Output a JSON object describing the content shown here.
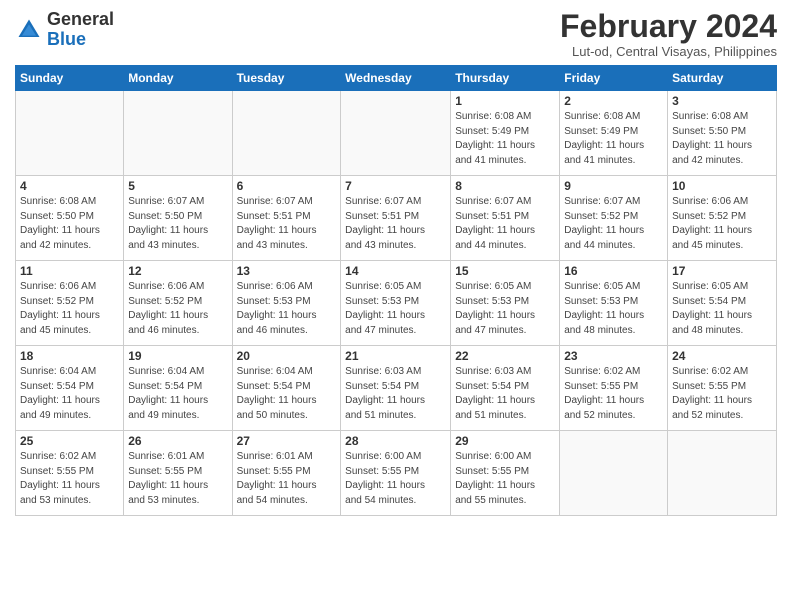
{
  "header": {
    "logo_general": "General",
    "logo_blue": "Blue",
    "month_title": "February 2024",
    "location": "Lut-od, Central Visayas, Philippines"
  },
  "weekdays": [
    "Sunday",
    "Monday",
    "Tuesday",
    "Wednesday",
    "Thursday",
    "Friday",
    "Saturday"
  ],
  "weeks": [
    [
      {
        "day": "",
        "info": ""
      },
      {
        "day": "",
        "info": ""
      },
      {
        "day": "",
        "info": ""
      },
      {
        "day": "",
        "info": ""
      },
      {
        "day": "1",
        "info": "Sunrise: 6:08 AM\nSunset: 5:49 PM\nDaylight: 11 hours\nand 41 minutes."
      },
      {
        "day": "2",
        "info": "Sunrise: 6:08 AM\nSunset: 5:49 PM\nDaylight: 11 hours\nand 41 minutes."
      },
      {
        "day": "3",
        "info": "Sunrise: 6:08 AM\nSunset: 5:50 PM\nDaylight: 11 hours\nand 42 minutes."
      }
    ],
    [
      {
        "day": "4",
        "info": "Sunrise: 6:08 AM\nSunset: 5:50 PM\nDaylight: 11 hours\nand 42 minutes."
      },
      {
        "day": "5",
        "info": "Sunrise: 6:07 AM\nSunset: 5:50 PM\nDaylight: 11 hours\nand 43 minutes."
      },
      {
        "day": "6",
        "info": "Sunrise: 6:07 AM\nSunset: 5:51 PM\nDaylight: 11 hours\nand 43 minutes."
      },
      {
        "day": "7",
        "info": "Sunrise: 6:07 AM\nSunset: 5:51 PM\nDaylight: 11 hours\nand 43 minutes."
      },
      {
        "day": "8",
        "info": "Sunrise: 6:07 AM\nSunset: 5:51 PM\nDaylight: 11 hours\nand 44 minutes."
      },
      {
        "day": "9",
        "info": "Sunrise: 6:07 AM\nSunset: 5:52 PM\nDaylight: 11 hours\nand 44 minutes."
      },
      {
        "day": "10",
        "info": "Sunrise: 6:06 AM\nSunset: 5:52 PM\nDaylight: 11 hours\nand 45 minutes."
      }
    ],
    [
      {
        "day": "11",
        "info": "Sunrise: 6:06 AM\nSunset: 5:52 PM\nDaylight: 11 hours\nand 45 minutes."
      },
      {
        "day": "12",
        "info": "Sunrise: 6:06 AM\nSunset: 5:52 PM\nDaylight: 11 hours\nand 46 minutes."
      },
      {
        "day": "13",
        "info": "Sunrise: 6:06 AM\nSunset: 5:53 PM\nDaylight: 11 hours\nand 46 minutes."
      },
      {
        "day": "14",
        "info": "Sunrise: 6:05 AM\nSunset: 5:53 PM\nDaylight: 11 hours\nand 47 minutes."
      },
      {
        "day": "15",
        "info": "Sunrise: 6:05 AM\nSunset: 5:53 PM\nDaylight: 11 hours\nand 47 minutes."
      },
      {
        "day": "16",
        "info": "Sunrise: 6:05 AM\nSunset: 5:53 PM\nDaylight: 11 hours\nand 48 minutes."
      },
      {
        "day": "17",
        "info": "Sunrise: 6:05 AM\nSunset: 5:54 PM\nDaylight: 11 hours\nand 48 minutes."
      }
    ],
    [
      {
        "day": "18",
        "info": "Sunrise: 6:04 AM\nSunset: 5:54 PM\nDaylight: 11 hours\nand 49 minutes."
      },
      {
        "day": "19",
        "info": "Sunrise: 6:04 AM\nSunset: 5:54 PM\nDaylight: 11 hours\nand 49 minutes."
      },
      {
        "day": "20",
        "info": "Sunrise: 6:04 AM\nSunset: 5:54 PM\nDaylight: 11 hours\nand 50 minutes."
      },
      {
        "day": "21",
        "info": "Sunrise: 6:03 AM\nSunset: 5:54 PM\nDaylight: 11 hours\nand 51 minutes."
      },
      {
        "day": "22",
        "info": "Sunrise: 6:03 AM\nSunset: 5:54 PM\nDaylight: 11 hours\nand 51 minutes."
      },
      {
        "day": "23",
        "info": "Sunrise: 6:02 AM\nSunset: 5:55 PM\nDaylight: 11 hours\nand 52 minutes."
      },
      {
        "day": "24",
        "info": "Sunrise: 6:02 AM\nSunset: 5:55 PM\nDaylight: 11 hours\nand 52 minutes."
      }
    ],
    [
      {
        "day": "25",
        "info": "Sunrise: 6:02 AM\nSunset: 5:55 PM\nDaylight: 11 hours\nand 53 minutes."
      },
      {
        "day": "26",
        "info": "Sunrise: 6:01 AM\nSunset: 5:55 PM\nDaylight: 11 hours\nand 53 minutes."
      },
      {
        "day": "27",
        "info": "Sunrise: 6:01 AM\nSunset: 5:55 PM\nDaylight: 11 hours\nand 54 minutes."
      },
      {
        "day": "28",
        "info": "Sunrise: 6:00 AM\nSunset: 5:55 PM\nDaylight: 11 hours\nand 54 minutes."
      },
      {
        "day": "29",
        "info": "Sunrise: 6:00 AM\nSunset: 5:55 PM\nDaylight: 11 hours\nand 55 minutes."
      },
      {
        "day": "",
        "info": ""
      },
      {
        "day": "",
        "info": ""
      }
    ]
  ]
}
